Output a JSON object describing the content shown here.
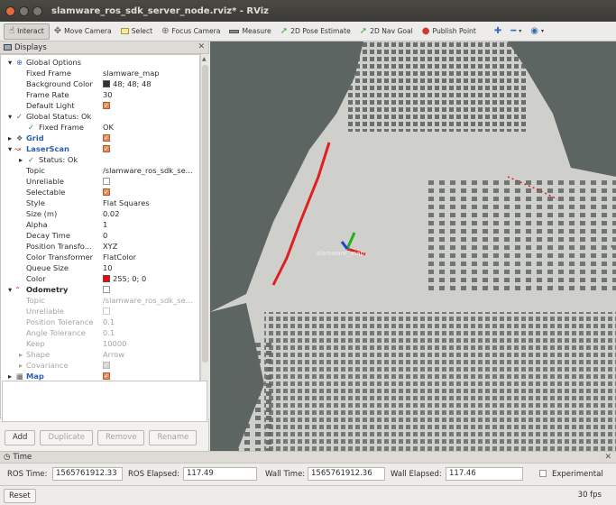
{
  "window": {
    "title": "slamware_ros_sdk_server_node.rviz* - RViz"
  },
  "toolbar": {
    "interact": "Interact",
    "move_camera": "Move Camera",
    "select": "Select",
    "focus_camera": "Focus Camera",
    "measure": "Measure",
    "pose_estimate": "2D Pose Estimate",
    "nav_goal": "2D Nav Goal",
    "publish_point": "Publish Point"
  },
  "displays": {
    "title": "Displays",
    "rows": [
      {
        "label": "Global Options",
        "value": ""
      },
      {
        "label": "Fixed Frame",
        "value": "slamware_map"
      },
      {
        "label": "Background Color",
        "value": "48; 48; 48"
      },
      {
        "label": "Frame Rate",
        "value": "30"
      },
      {
        "label": "Default Light",
        "value": ""
      },
      {
        "label": "Global Status: Ok",
        "value": ""
      },
      {
        "label": "Fixed Frame",
        "value": "OK"
      },
      {
        "label": "Grid",
        "value": ""
      },
      {
        "label": "LaserScan",
        "value": ""
      },
      {
        "label": "Status: Ok",
        "value": ""
      },
      {
        "label": "Topic",
        "value": "/slamware_ros_sdk_se..."
      },
      {
        "label": "Unreliable",
        "value": ""
      },
      {
        "label": "Selectable",
        "value": ""
      },
      {
        "label": "Style",
        "value": "Flat Squares"
      },
      {
        "label": "Size (m)",
        "value": "0.02"
      },
      {
        "label": "Alpha",
        "value": "1"
      },
      {
        "label": "Decay Time",
        "value": "0"
      },
      {
        "label": "Position Transfo...",
        "value": "XYZ"
      },
      {
        "label": "Color Transformer",
        "value": "FlatColor"
      },
      {
        "label": "Queue Size",
        "value": "10"
      },
      {
        "label": "Color",
        "value": "255; 0; 0"
      },
      {
        "label": "Odometry",
        "value": ""
      },
      {
        "label": "Topic",
        "value": "/slamware_ros_sdk_se..."
      },
      {
        "label": "Unreliable",
        "value": ""
      },
      {
        "label": "Position Tolerance",
        "value": "0.1"
      },
      {
        "label": "Angle Tolerance",
        "value": "0.1"
      },
      {
        "label": "Keep",
        "value": "10000"
      },
      {
        "label": "Shape",
        "value": "Arrow"
      },
      {
        "label": "Covariance",
        "value": ""
      },
      {
        "label": "Map",
        "value": ""
      }
    ],
    "buttons": {
      "add": "Add",
      "duplicate": "Duplicate",
      "remove": "Remove",
      "rename": "Rename"
    }
  },
  "view": {
    "frame_label": "slamware_map"
  },
  "time": {
    "title": "Time",
    "ros_time_label": "ROS Time:",
    "ros_time": "1565761912.33",
    "ros_elapsed_label": "ROS Elapsed:",
    "ros_elapsed": "117.49",
    "wall_time_label": "Wall Time:",
    "wall_time": "1565761912.36",
    "wall_elapsed_label": "Wall Elapsed:",
    "wall_elapsed": "117.46",
    "experimental": "Experimental"
  },
  "status": {
    "reset": "Reset",
    "fps": "30 fps"
  },
  "colors": {
    "background_swatch": "#303030",
    "laser_swatch": "#ff0000",
    "accent_orange": "#e88a5a"
  }
}
